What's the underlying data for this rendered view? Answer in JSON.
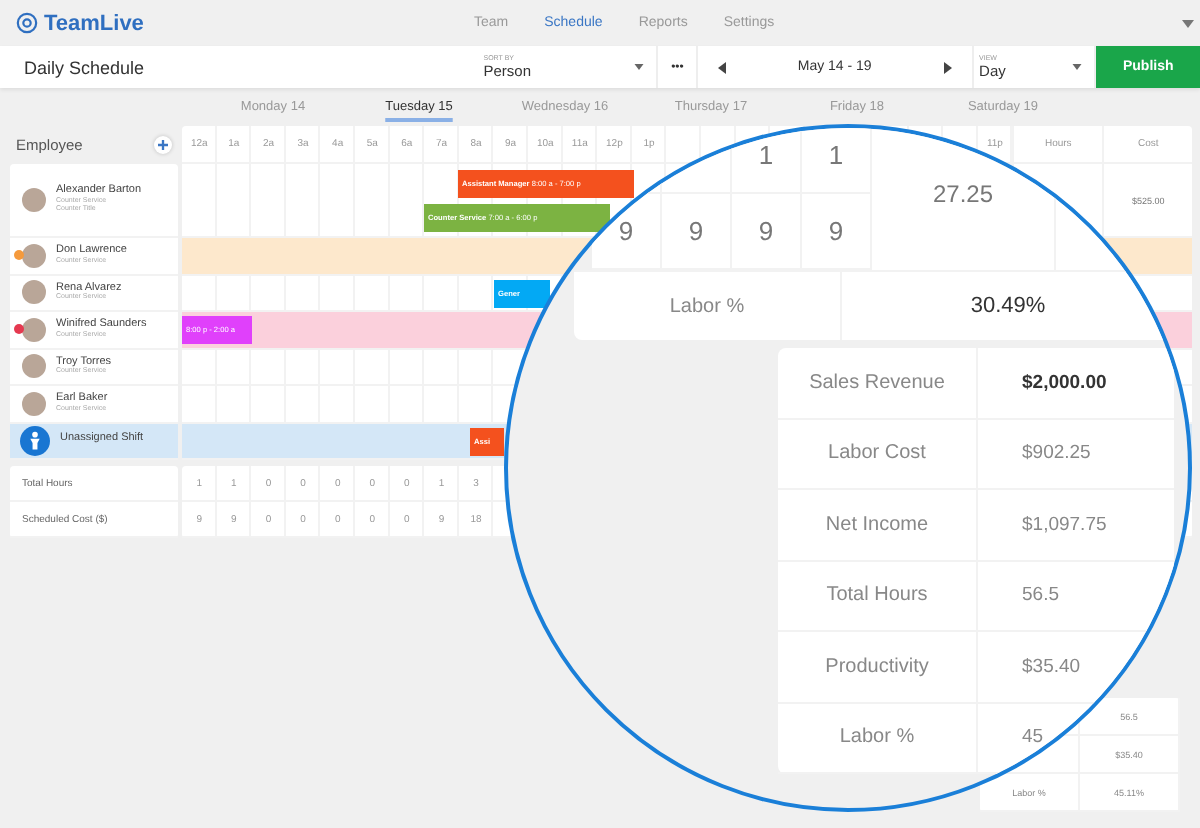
{
  "brand": {
    "name": "TeamLive"
  },
  "nav": [
    {
      "label": "Team",
      "selected": false
    },
    {
      "label": "Schedule",
      "selected": true
    },
    {
      "label": "Reports",
      "selected": false
    },
    {
      "label": "Settings",
      "selected": false
    }
  ],
  "toolbar": {
    "title": "Daily Schedule",
    "sort": {
      "caption": "SORT BY",
      "value": "Person"
    },
    "more": "•••",
    "date_range": "May 14 - 19",
    "view": {
      "caption": "VIEW",
      "value": "Day"
    },
    "publish": "Publish"
  },
  "days": [
    {
      "label": "Monday 14",
      "selected": false
    },
    {
      "label": "Tuesday 15",
      "selected": true
    },
    {
      "label": "Wednesday 16",
      "selected": false
    },
    {
      "label": "Thursday 17",
      "selected": false
    },
    {
      "label": "Friday 18",
      "selected": false
    },
    {
      "label": "Saturday 19",
      "selected": false
    }
  ],
  "schedule": {
    "employee_heading": "Employee",
    "hours": [
      "12a",
      "1a",
      "2a",
      "3a",
      "4a",
      "5a",
      "6a",
      "7a",
      "8a",
      "9a",
      "10a",
      "11a",
      "12p",
      "1p"
    ],
    "last_hour": "11p",
    "hours_heading": "Hours",
    "cost_heading": "Cost",
    "rows": [
      {
        "kind": "person",
        "name": "Alexander Barton",
        "role": "Counter Service",
        "title": "Counter Title",
        "time_off": false,
        "conflict": false,
        "selected": false,
        "cost": "$525.00",
        "shifts": [
          {
            "title": "Assistant Manager",
            "time": "8:00 a - 7:00 p",
            "color": "#f4511e"
          },
          {
            "title": "Counter Service",
            "time": "7:00 a - 6:00 p",
            "color": "#7cb342"
          }
        ]
      },
      {
        "kind": "person",
        "name": "Don Lawrence",
        "role": "Counter Service",
        "time_off": true,
        "conflict": false,
        "selected": false,
        "color": "#f59a3c",
        "shifts": []
      },
      {
        "kind": "person",
        "name": "Rena Alvarez",
        "role": "Counter Service",
        "time_off": false,
        "conflict": false,
        "selected": false,
        "shifts": [
          {
            "title": "Gener",
            "color": "#03a9f4"
          }
        ]
      },
      {
        "kind": "person",
        "name": "Winifred Saunders",
        "role": "Counter Service",
        "time_off": false,
        "conflict": true,
        "selected": false,
        "color": "#e53950",
        "shifts": [
          {
            "time": "8:00 p - 2:00 a",
            "color": "#e040fb"
          }
        ]
      },
      {
        "kind": "person",
        "name": "Troy Torres",
        "role": "Counter Service",
        "time_off": false,
        "conflict": false,
        "selected": false,
        "shifts": []
      },
      {
        "kind": "person",
        "name": "Earl Baker",
        "role": "Counter Service",
        "time_off": false,
        "conflict": false,
        "selected": false,
        "shifts": []
      },
      {
        "kind": "unassigned",
        "name": "Unassigned Shift",
        "time_off": false,
        "conflict": false,
        "selected": true,
        "shifts": [
          {
            "title": "Assi",
            "color": "#f4511e"
          }
        ]
      }
    ],
    "totals": [
      {
        "label": "Total Hours",
        "values": [
          "1",
          "1",
          "0",
          "0",
          "0",
          "0",
          "0",
          "1",
          "3"
        ]
      },
      {
        "label": "Scheduled Cost ($)",
        "values": [
          "9",
          "9",
          "0",
          "0",
          "0",
          "0",
          "0",
          "9",
          "18"
        ]
      }
    ]
  },
  "mini_summary": [
    {
      "value": "56.5"
    },
    {
      "value": "$35.40"
    },
    {
      "label": "Labor %",
      "value": "45.11%"
    }
  ],
  "magnifier": {
    "grid_rows": [
      [
        "1",
        "1"
      ],
      [
        "9",
        "9",
        "9",
        "9"
      ]
    ],
    "grid_total": "27.25",
    "labor": {
      "label": "Labor %",
      "value": "30.49%"
    },
    "summary": [
      {
        "label": "Sales Revenue",
        "value": "$2,000.00",
        "emphasis": true
      },
      {
        "label": "Labor Cost",
        "value": "$902.25",
        "emphasis": false
      },
      {
        "label": "Net Income",
        "value": "$1,097.75",
        "emphasis": false
      },
      {
        "label": "Total Hours",
        "value": "56.5",
        "emphasis": false
      },
      {
        "label": "Productivity",
        "value": "$35.40",
        "emphasis": false
      },
      {
        "label": "Labor %",
        "value": "45",
        "emphasis": false
      }
    ]
  }
}
